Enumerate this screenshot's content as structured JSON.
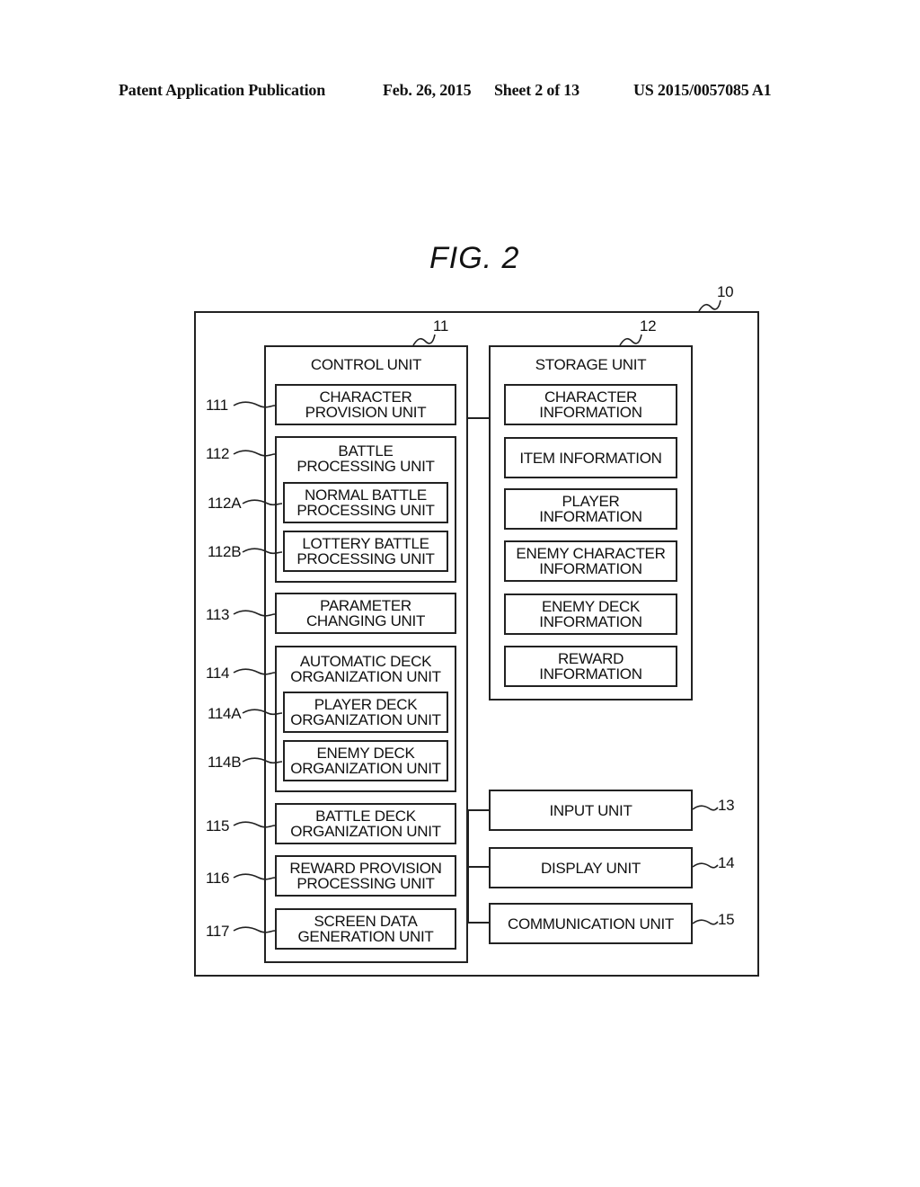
{
  "header": {
    "publication": "Patent Application Publication",
    "date": "Feb. 26, 2015",
    "sheet": "Sheet 2 of 13",
    "number": "US 2015/0057085 A1"
  },
  "figure": {
    "title": "FIG. 2"
  },
  "diagram": {
    "outer": {
      "ref": "10"
    },
    "control_unit": {
      "ref": "11",
      "title": "CONTROL UNIT",
      "blocks": [
        {
          "ref": "111",
          "label": "CHARACTER\nPROVISION UNIT"
        },
        {
          "ref": "112",
          "label": "BATTLE\nPROCESSING UNIT",
          "children": [
            {
              "ref": "112A",
              "label": "NORMAL BATTLE\nPROCESSING UNIT"
            },
            {
              "ref": "112B",
              "label": "LOTTERY BATTLE\nPROCESSING UNIT"
            }
          ]
        },
        {
          "ref": "113",
          "label": "PARAMETER\nCHANGING UNIT"
        },
        {
          "ref": "114",
          "label": "AUTOMATIC DECK\nORGANIZATION UNIT",
          "children": [
            {
              "ref": "114A",
              "label": "PLAYER DECK\nORGANIZATION UNIT"
            },
            {
              "ref": "114B",
              "label": "ENEMY DECK\nORGANIZATION UNIT"
            }
          ]
        },
        {
          "ref": "115",
          "label": "BATTLE DECK\nORGANIZATION UNIT"
        },
        {
          "ref": "116",
          "label": "REWARD PROVISION\nPROCESSING UNIT"
        },
        {
          "ref": "117",
          "label": "SCREEN DATA\nGENERATION UNIT"
        }
      ]
    },
    "storage_unit": {
      "ref": "12",
      "title": "STORAGE UNIT",
      "blocks": [
        {
          "label": "CHARACTER\nINFORMATION"
        },
        {
          "label": "ITEM INFORMATION"
        },
        {
          "label": "PLAYER\nINFORMATION"
        },
        {
          "label": "ENEMY CHARACTER\nINFORMATION"
        },
        {
          "label": "ENEMY DECK\nINFORMATION"
        },
        {
          "label": "REWARD\nINFORMATION"
        }
      ]
    },
    "io_units": [
      {
        "ref": "13",
        "label": "INPUT UNIT"
      },
      {
        "ref": "14",
        "label": "DISPLAY UNIT"
      },
      {
        "ref": "15",
        "label": "COMMUNICATION UNIT"
      }
    ]
  }
}
